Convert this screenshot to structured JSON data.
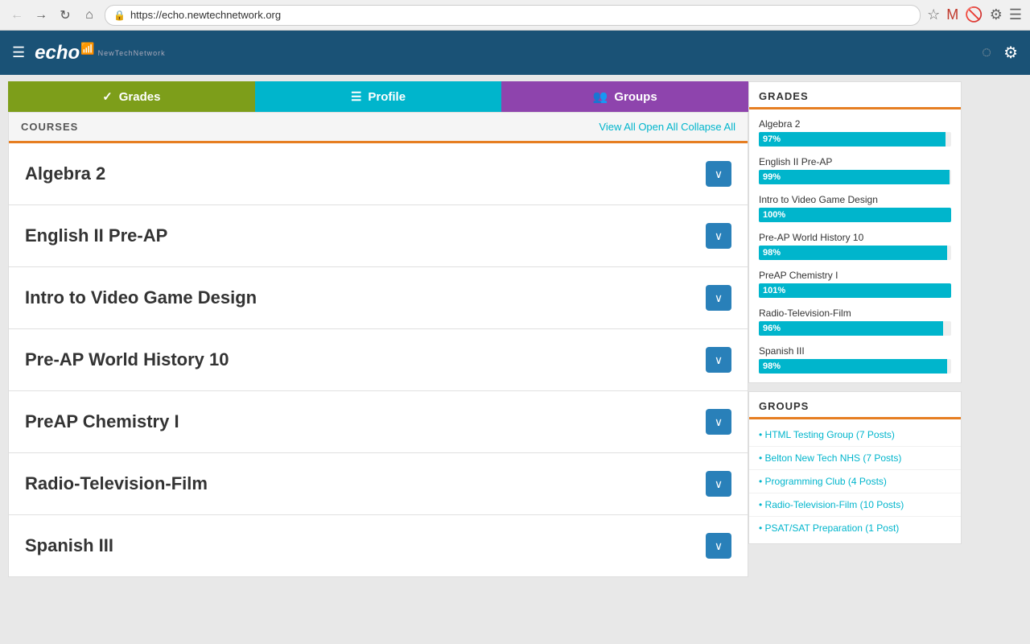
{
  "browser": {
    "url": "https://echo.newtechnetwork.org",
    "back_icon": "◀",
    "forward_icon": "▶",
    "refresh_icon": "↻",
    "home_icon": "⌂"
  },
  "header": {
    "logo_text": "echo",
    "logo_subtitle": "NewTechNetwork",
    "menu_icon": "☰",
    "spinner_icon": "◌",
    "settings_icon": "⚙"
  },
  "tabs": [
    {
      "id": "grades",
      "label": "Grades",
      "icon": "✓",
      "class": "tab-grades"
    },
    {
      "id": "profile",
      "label": "Profile",
      "icon": "☰",
      "class": "tab-profile"
    },
    {
      "id": "groups",
      "label": "Groups",
      "icon": "👥",
      "class": "tab-groups"
    }
  ],
  "courses": {
    "header_label": "COURSES",
    "actions": "View All  Open All  Collapse All",
    "items": [
      {
        "name": "Algebra 2"
      },
      {
        "name": "English II Pre-AP"
      },
      {
        "name": "Intro to Video Game Design"
      },
      {
        "name": "Pre-AP World History 10"
      },
      {
        "name": "PreAP Chemistry I"
      },
      {
        "name": "Radio-Television-Film"
      },
      {
        "name": "Spanish III"
      }
    ]
  },
  "grades_sidebar": {
    "title": "GRADES",
    "items": [
      {
        "name": "Algebra 2",
        "percent": 97,
        "label": "97%"
      },
      {
        "name": "English II Pre-AP",
        "percent": 99,
        "label": "99%"
      },
      {
        "name": "Intro to Video Game Design",
        "percent": 100,
        "label": "100%"
      },
      {
        "name": "Pre-AP World History 10",
        "percent": 98,
        "label": "98%"
      },
      {
        "name": "PreAP Chemistry I",
        "percent": 101,
        "label": "101%"
      },
      {
        "name": "Radio-Television-Film",
        "percent": 96,
        "label": "96%"
      },
      {
        "name": "Spanish III",
        "percent": 98,
        "label": "98%"
      }
    ]
  },
  "groups_sidebar": {
    "title": "GROUPS",
    "items": [
      {
        "label": "• HTML Testing Group (7  Posts)"
      },
      {
        "label": "• Belton New Tech NHS (7  Posts)"
      },
      {
        "label": "• Programming Club (4  Posts)"
      },
      {
        "label": "• Radio-Television-Film (10  Posts)"
      },
      {
        "label": "• PSAT/SAT Preparation (1  Post)"
      }
    ]
  }
}
